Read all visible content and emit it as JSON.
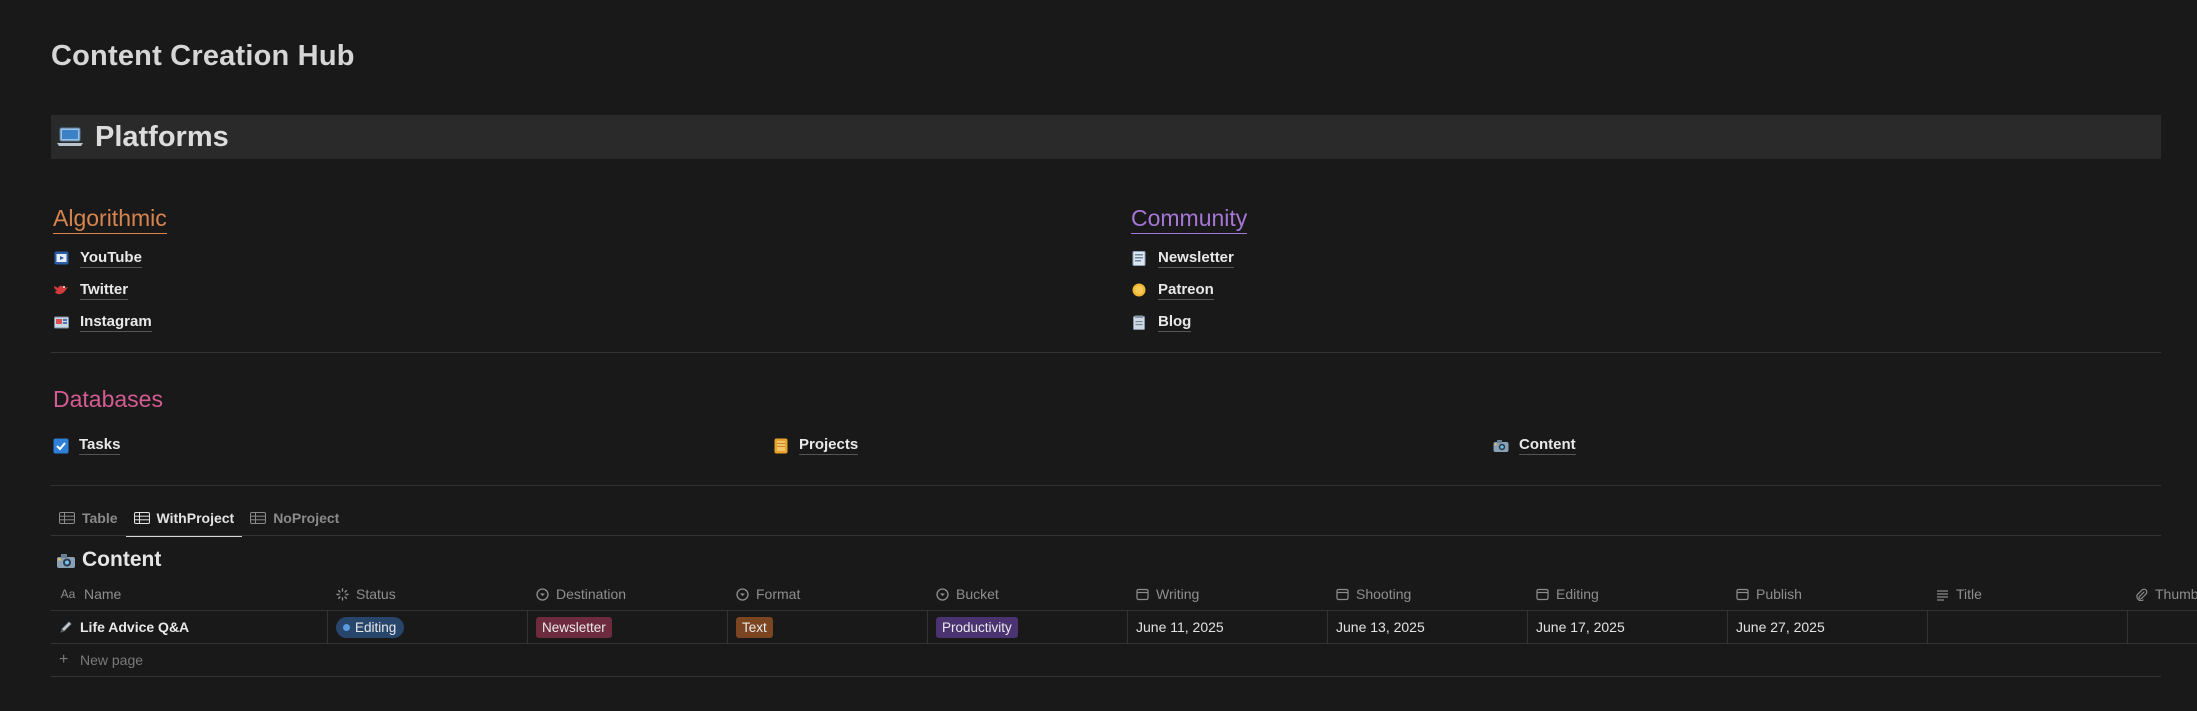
{
  "page": {
    "title": "Content Creation Hub"
  },
  "platforms": {
    "heading": "Platforms",
    "heading_icon": "laptop-icon",
    "algorithmic": {
      "label": "Algorithmic",
      "color": "#d7844f",
      "items": [
        {
          "label": "YouTube",
          "icon": "youtube-icon"
        },
        {
          "label": "Twitter",
          "icon": "twitter-icon"
        },
        {
          "label": "Instagram",
          "icon": "instagram-icon"
        }
      ]
    },
    "community": {
      "label": "Community",
      "color": "#a576d6",
      "items": [
        {
          "label": "Newsletter",
          "icon": "newsletter-icon"
        },
        {
          "label": "Patreon",
          "icon": "patreon-icon"
        },
        {
          "label": "Blog",
          "icon": "blog-icon"
        }
      ]
    }
  },
  "databases": {
    "label": "Databases",
    "color": "#d45c93",
    "items": [
      {
        "label": "Tasks",
        "icon": "checkbox-icon"
      },
      {
        "label": "Projects",
        "icon": "folder-icon"
      },
      {
        "label": "Content",
        "icon": "camera-icon"
      }
    ]
  },
  "views": {
    "tabs": [
      {
        "label": "Table",
        "active": false
      },
      {
        "label": "WithProject",
        "active": true
      },
      {
        "label": "NoProject",
        "active": false
      }
    ]
  },
  "table": {
    "title": "Content",
    "columns": [
      {
        "label": "Name",
        "icon": "aa-text-icon"
      },
      {
        "label": "Status",
        "icon": "status-icon"
      },
      {
        "label": "Destination",
        "icon": "select-icon"
      },
      {
        "label": "Format",
        "icon": "select-icon"
      },
      {
        "label": "Bucket",
        "icon": "select-icon"
      },
      {
        "label": "Writing",
        "icon": "calendar-icon"
      },
      {
        "label": "Shooting",
        "icon": "calendar-icon"
      },
      {
        "label": "Editing",
        "icon": "calendar-icon"
      },
      {
        "label": "Publish",
        "icon": "calendar-icon"
      },
      {
        "label": "Title",
        "icon": "text-lines-icon"
      },
      {
        "label": "Thumb",
        "icon": "paperclip-icon"
      }
    ],
    "rows": [
      {
        "name": "Life Advice Q&A",
        "status": "Editing",
        "destination": "Newsletter",
        "format": "Text",
        "bucket": "Productivity",
        "writing": "June 11, 2025",
        "shooting": "June 13, 2025",
        "editing": "June 17, 2025",
        "publish": "June 27, 2025",
        "title": "",
        "thumb": ""
      }
    ],
    "new_page_label": "New page",
    "tag_colors": {
      "destination": "#6e2a3f",
      "format": "#7a4520",
      "bucket": "#4b3372",
      "status": "#28456c"
    }
  }
}
